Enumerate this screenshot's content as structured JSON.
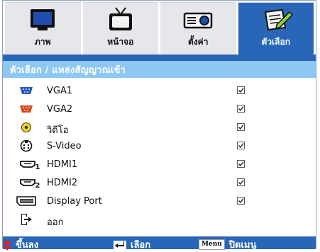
{
  "tabs": [
    {
      "label": "ภาพ",
      "icon": "display-icon",
      "active": false
    },
    {
      "label": "หน้าจอ",
      "icon": "tv-icon",
      "active": false
    },
    {
      "label": "ตั้งค่า",
      "icon": "projector-icon",
      "active": false
    },
    {
      "label": "ตัวเลือก",
      "icon": "notepad-pen-icon",
      "active": true
    }
  ],
  "title": "ตัวเลือก / แหล่งสัญญาณเข้า",
  "items": [
    {
      "label": "VGA1",
      "icon": "vga-icon",
      "color": "#2a5ac0",
      "checked": true
    },
    {
      "label": "VGA2",
      "icon": "vga-icon",
      "color": "#d84a1a",
      "checked": true
    },
    {
      "label": "วิดีโอ",
      "icon": "video-rca-icon",
      "color": "#f2d21a",
      "checked": true
    },
    {
      "label": "S-Video",
      "icon": "svideo-icon",
      "checked": true
    },
    {
      "label": "HDMI1",
      "icon": "hdmi-icon",
      "subscript": "1",
      "checked": true
    },
    {
      "label": "HDMI2",
      "icon": "hdmi-icon",
      "subscript": "2",
      "checked": true
    },
    {
      "label": "Display Port",
      "icon": "displayport-icon",
      "checked": true
    },
    {
      "label": "ออก",
      "icon": "exit-icon",
      "checked": false
    }
  ],
  "bottom": {
    "navigate_label": "ขึ้นลง",
    "select_label": "เลือก",
    "menu_key": "Menu",
    "close_label": "ปิดเมนู"
  }
}
